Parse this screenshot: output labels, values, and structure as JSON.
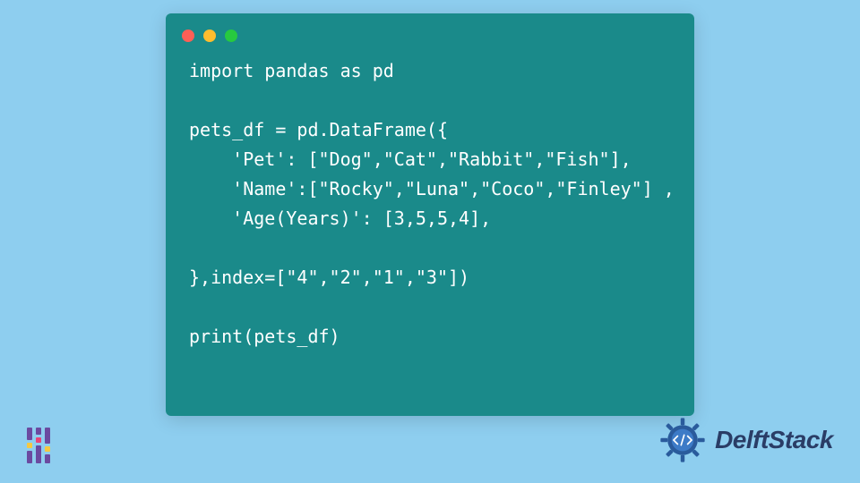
{
  "code": {
    "line1": "import pandas as pd",
    "line2": "",
    "line3": "pets_df = pd.DataFrame({",
    "line4": "    'Pet': [\"Dog\",\"Cat\",\"Rabbit\",\"Fish\"],",
    "line5": "    'Name':[\"Rocky\",\"Luna\",\"Coco\",\"Finley\"] ,",
    "line6": "    'Age(Years)': [3,5,5,4],",
    "line7": "",
    "line8": "},index=[\"4\",\"2\",\"1\",\"3\"])",
    "line9": "",
    "line10": "print(pets_df)"
  },
  "brand": {
    "name": "DelftStack"
  },
  "window": {
    "close_label": "close",
    "minimize_label": "minimize",
    "maximize_label": "maximize"
  }
}
